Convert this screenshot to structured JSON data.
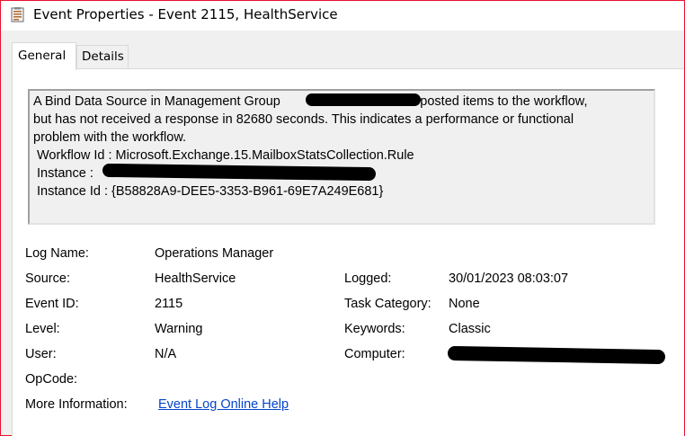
{
  "window": {
    "title": "Event Properties - Event 2115, HealthService",
    "app_icon": "event-viewer-icon",
    "border_color": "#e8112d"
  },
  "tabs": [
    {
      "label": "General",
      "selected": true
    },
    {
      "label": "Details",
      "selected": false
    }
  ],
  "description": {
    "line1_pre": "A Bind Data Source in Management Group ",
    "line1_post": "has posted items to the workflow,",
    "line2": "but has not received a response in 82680 seconds.  This indicates a performance or functional",
    "line3": "problem with the workflow.",
    "workflow": " Workflow Id : Microsoft.Exchange.15.MailboxStatsCollection.Rule",
    "instance": " Instance    : ",
    "instance_id": " Instance Id : {B58828A9-DEE5-3353-B961-69E7A249E681}"
  },
  "fields": {
    "log_name_label": "Log Name:",
    "log_name_value": "Operations Manager",
    "source_label": "Source:",
    "source_value": "HealthService",
    "logged_label": "Logged:",
    "logged_value": "30/01/2023 08:03:07",
    "event_id_label": "Event ID:",
    "event_id_value": "2115",
    "task_category_label": "Task Category:",
    "task_category_value": "None",
    "level_label": "Level:",
    "level_value": "Warning",
    "keywords_label": "Keywords:",
    "keywords_value": "Classic",
    "user_label": "User:",
    "user_value": "N/A",
    "computer_label": "Computer:",
    "opcode_label": "OpCode:",
    "more_info_label": "More Information:",
    "more_info_link": "Event Log Online Help"
  },
  "colors": {
    "link": "#0645c8",
    "panel_bg": "#ffffff",
    "description_bg": "#f0f0f0"
  }
}
